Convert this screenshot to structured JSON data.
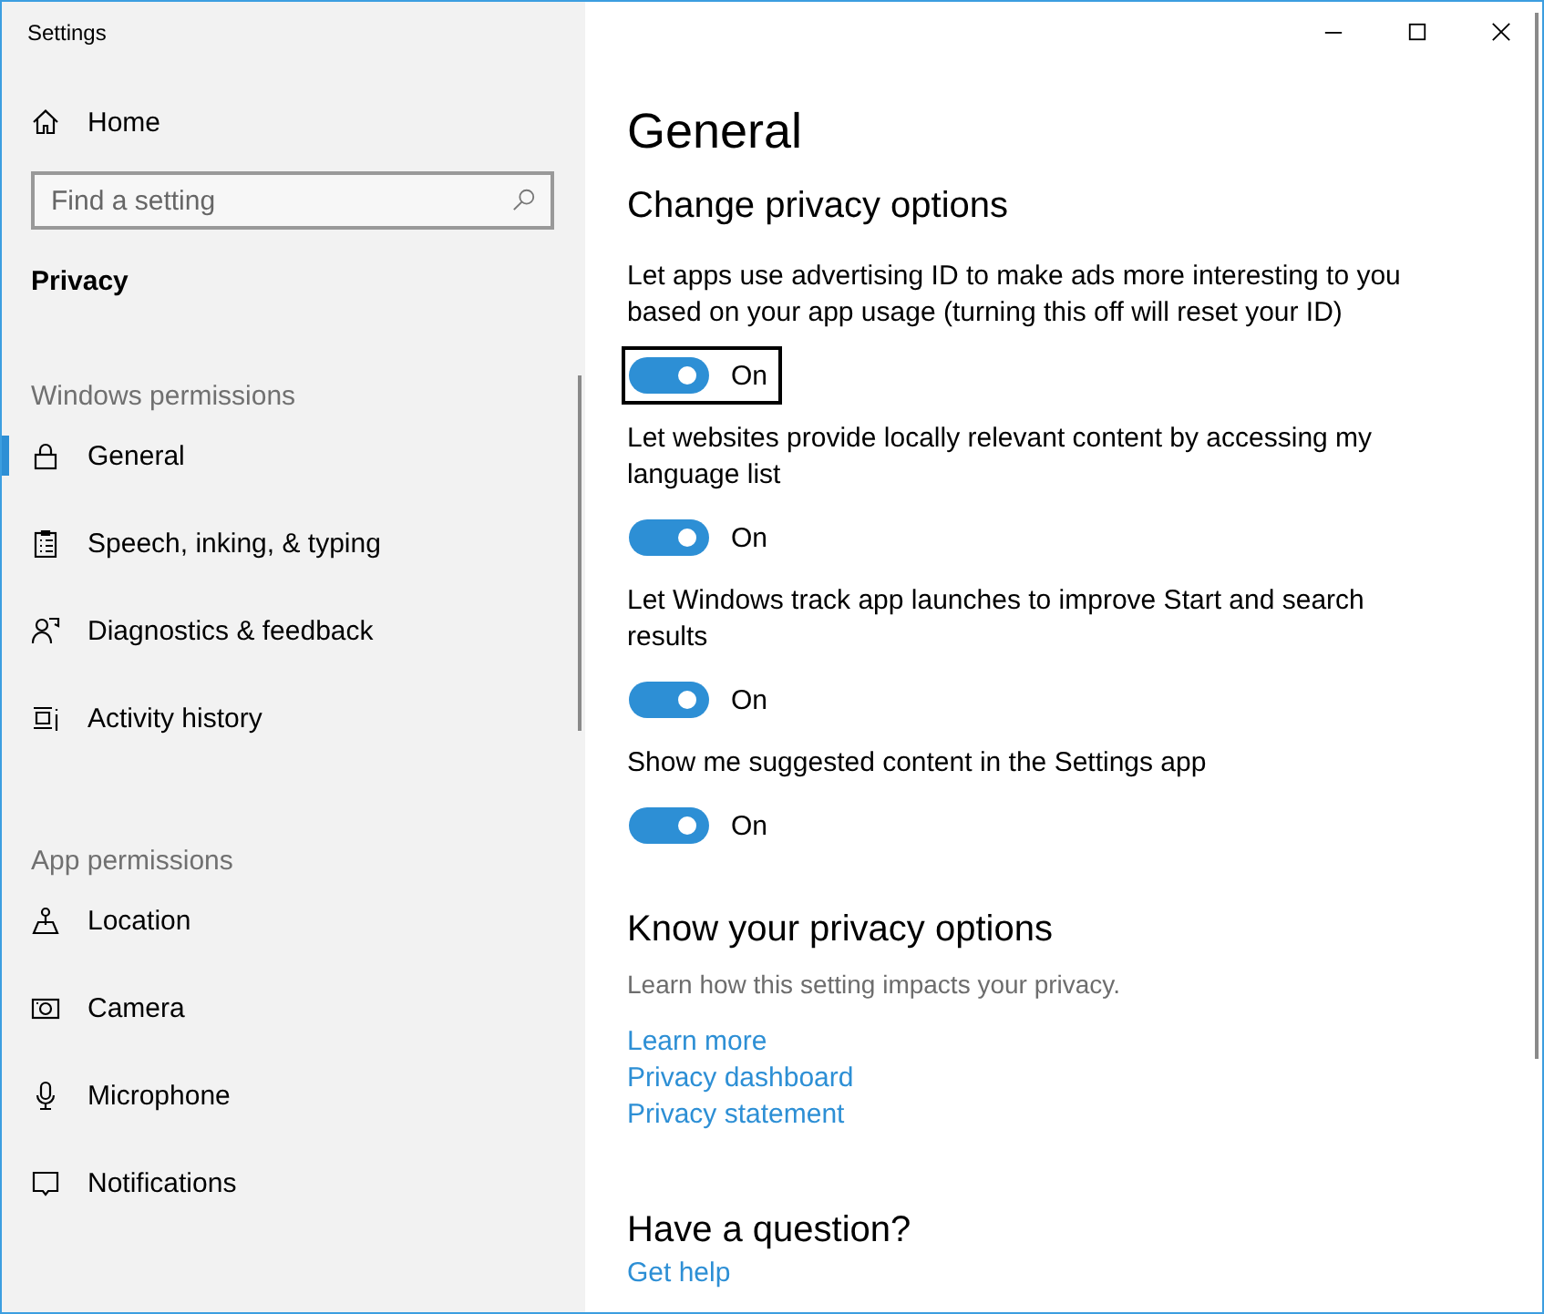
{
  "window": {
    "title": "Settings",
    "controls": [
      {
        "kind": "minimize"
      },
      {
        "kind": "maximize"
      },
      {
        "kind": "close"
      }
    ]
  },
  "sidebar": {
    "home": {
      "label": "Home"
    },
    "search": {
      "placeholder": "Find a setting"
    },
    "section_title": "Privacy",
    "groups": [
      {
        "heading": "Windows permissions",
        "items": [
          {
            "label": "General",
            "selected": true
          },
          {
            "label": "Speech, inking, & typing",
            "selected": false
          },
          {
            "label": "Diagnostics & feedback",
            "selected": false
          },
          {
            "label": "Activity history",
            "selected": false
          }
        ]
      },
      {
        "heading": "App permissions",
        "items": [
          {
            "label": "Location",
            "selected": false
          },
          {
            "label": "Camera",
            "selected": false
          },
          {
            "label": "Microphone",
            "selected": false
          },
          {
            "label": "Notifications",
            "selected": false
          }
        ]
      }
    ]
  },
  "main": {
    "title": "General",
    "section": "Change privacy options",
    "options": [
      {
        "description": "Let apps use advertising ID to make ads more interesting to you based on your app usage (turning this off will reset your ID)",
        "on": true,
        "state_label": "On",
        "focused": true
      },
      {
        "description": "Let websites provide locally relevant content by accessing my language list",
        "on": true,
        "state_label": "On",
        "focused": false
      },
      {
        "description": "Let Windows track app launches to improve Start and search results",
        "on": true,
        "state_label": "On",
        "focused": false
      },
      {
        "description": "Show me suggested content in the Settings app",
        "on": true,
        "state_label": "On",
        "focused": false
      }
    ],
    "know": {
      "title": "Know your privacy options",
      "text": "Learn how this setting impacts your privacy.",
      "links": [
        "Learn more",
        "Privacy dashboard",
        "Privacy statement"
      ]
    },
    "question": {
      "title": "Have a question?",
      "links": [
        "Get help"
      ]
    }
  }
}
